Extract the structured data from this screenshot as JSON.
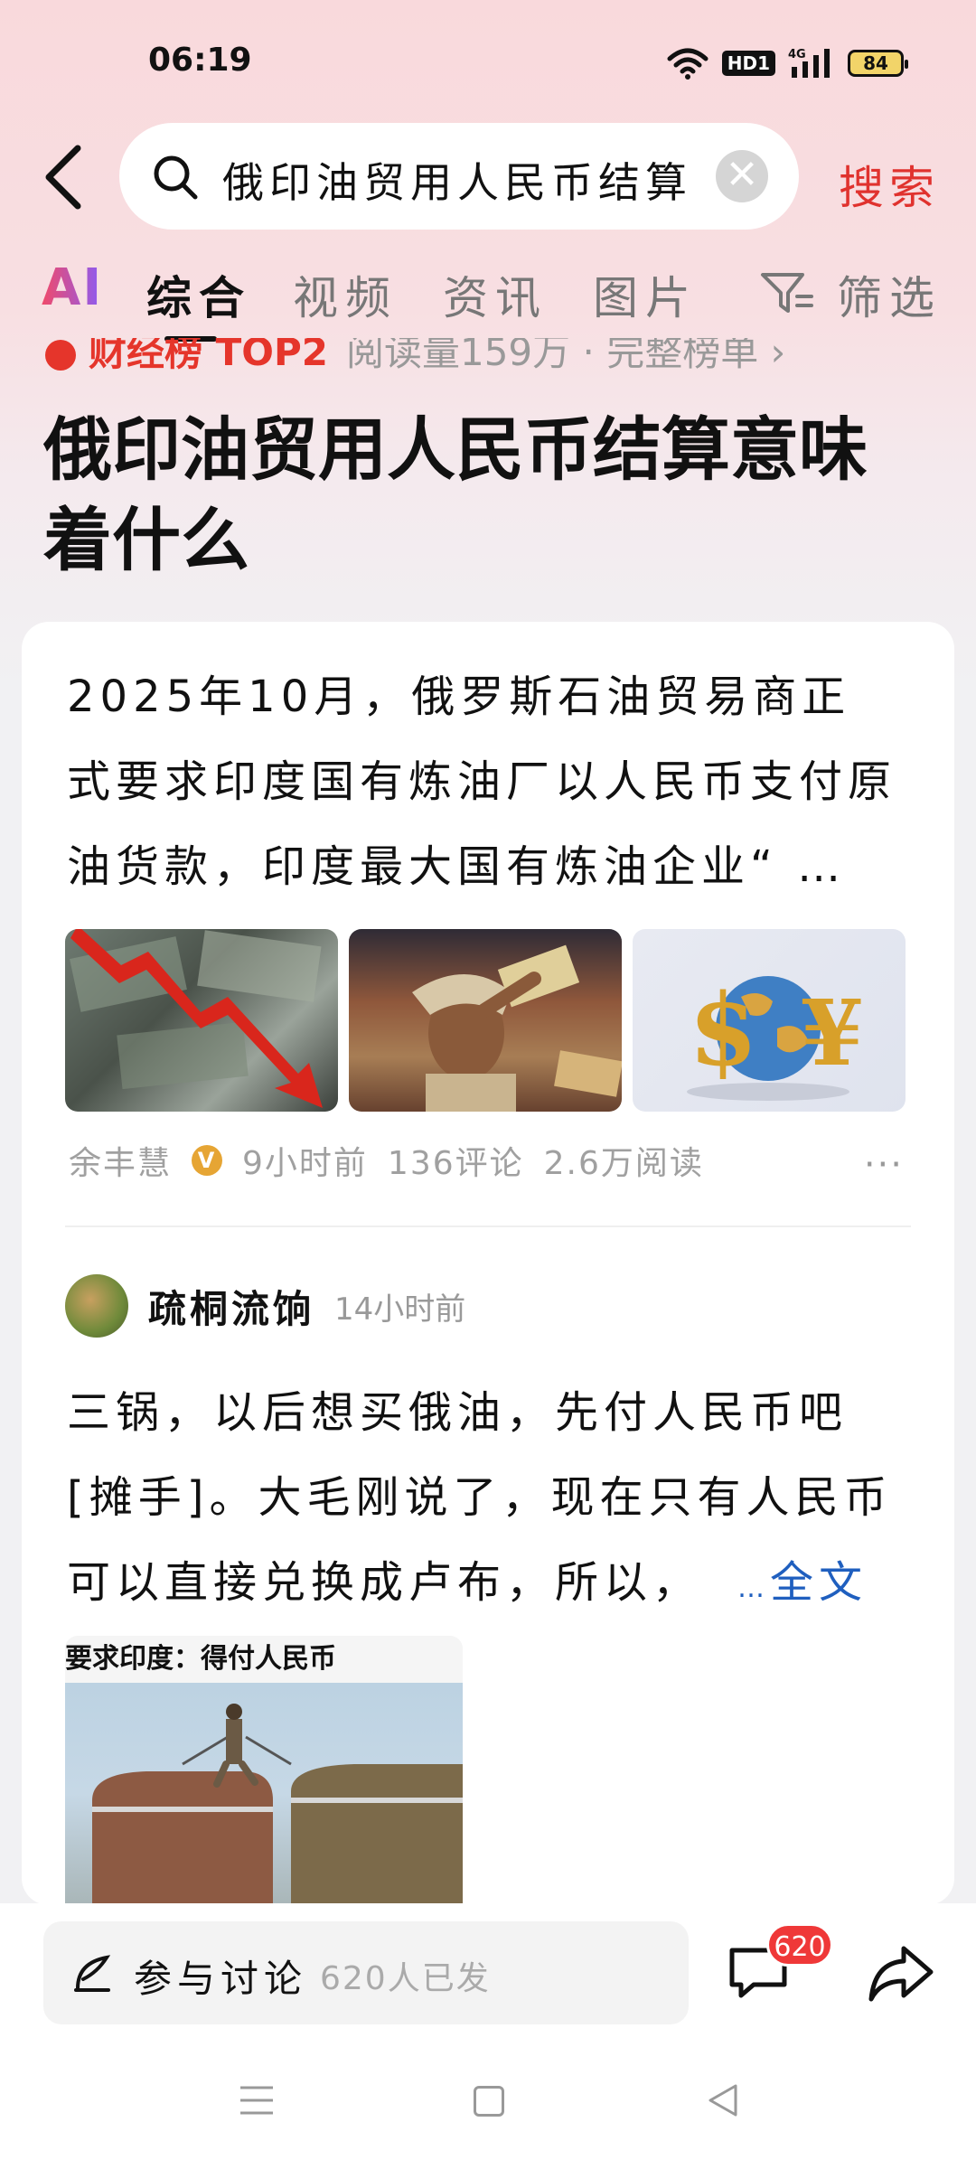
{
  "status_bar": {
    "time": "06:19",
    "hd_label": "HD1",
    "network": "4G",
    "battery": "84"
  },
  "search": {
    "query": "俄印油贸用人民币结算",
    "clear_symbol": "✕",
    "button_label": "搜索"
  },
  "tabs": {
    "ai": "AI",
    "items": [
      "综合",
      "视频",
      "资讯",
      "图片"
    ],
    "active": "综合",
    "filter_label": "筛选"
  },
  "rank": {
    "label": "财经榜 TOP2",
    "meta": "阅读量159万 · 完整榜单 ›"
  },
  "headline": "俄印油贸用人民币结算意味着什么",
  "article": {
    "text": "2025年10月，俄罗斯石油贸易商正式要求印度国有炼油厂以人民币支付原油货款，印度最大国有炼油企业“ …",
    "images": [
      "falling-dollar-chart",
      "man-holding-rupee-notes",
      "globe-with-currency-symbols"
    ],
    "author": "余丰慧",
    "time": "9小时前",
    "comments": "136评论",
    "reads": "2.6万阅读",
    "more_symbol": "···"
  },
  "comment": {
    "user": "疏桐流饷",
    "time": "14小时前",
    "text": "三锅，以后想买俄油，先付人民币吧[摊手]。大毛刚说了，现在只有人民币可以直接兑换成卢布，所以，",
    "ellipsis": "…",
    "full_link": "全文",
    "image_caption": "要求印度：得付人民币"
  },
  "bottom_bar": {
    "discuss_label": "参与讨论",
    "discuss_count": "620人已发",
    "comment_badge": "620"
  },
  "colors": {
    "accent_red": "#e0322e",
    "link_blue": "#1f5fbf",
    "badge_red": "#ef3838"
  }
}
